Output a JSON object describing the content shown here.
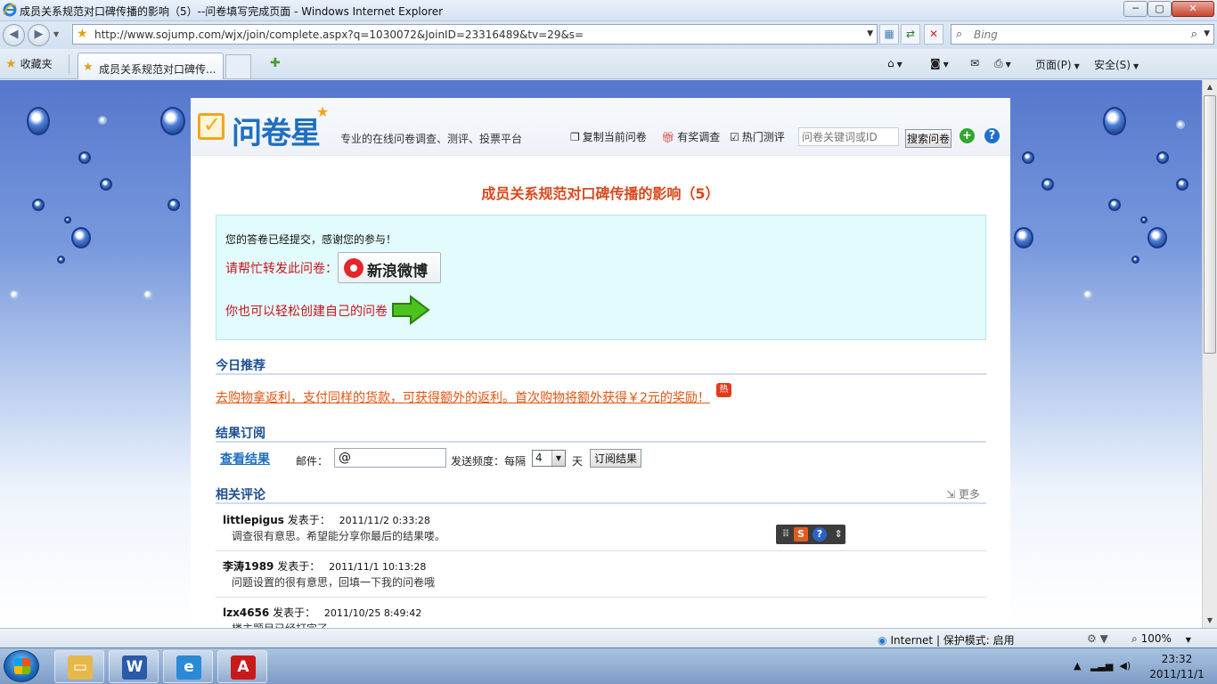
{
  "window": {
    "title": "成员关系规范对口碑传播的影响（5）--问卷填写完成页面 - Windows Internet Explorer",
    "min": "─",
    "max": "▢",
    "close": "✕"
  },
  "addressbar": {
    "url": "http://www.sojump.com/wjx/join/complete.aspx?q=1030072&JoinID=23316489&tv=29&s=",
    "search_placeholder": "Bing"
  },
  "favorites": {
    "label": "收藏夹",
    "tab_title": "成员关系规范对口碑传..."
  },
  "commandbar": {
    "page_menu": "页面(P)",
    "safety_menu": "安全(S)"
  },
  "site": {
    "logo_text": "问卷星",
    "slogan": "专业的在线问卷调查、测评、投票平台",
    "links": {
      "copy": "复制当前问卷",
      "reward": "有奖调查",
      "hot": "热门测评"
    },
    "search_placeholder": "问卷关键词或ID",
    "search_button": "搜索问卷"
  },
  "survey": {
    "title": "成员关系规范对口碑传播的影响（5）",
    "thanks": "您的答卷已经提交，感谢您的参与！",
    "share_label": "请帮忙转发此问卷：",
    "weibo_label": "新浪微博",
    "create_label": "你也可以轻松创建自己的问卷"
  },
  "recommend": {
    "title": "今日推荐",
    "promo": "去购物拿返利，支付同样的货款，可获得额外的返利。首次购物将额外获得￥2元的奖励！",
    "badge": "热"
  },
  "subscribe": {
    "title": "结果订阅",
    "view_result": "查看结果",
    "mail_label": "邮件：",
    "mail_value": "@",
    "freq_label": "发送频度：每隔",
    "freq_value": "4",
    "day_label": "天",
    "button": "订阅结果"
  },
  "comments": {
    "title": "相关评论",
    "more": "更多",
    "posted_label": "发表于：",
    "items": [
      {
        "user": "littlepigus",
        "time": "2011/11/2 0:33:28",
        "text": "调查很有意思。希望能分享你最后的结果喽。"
      },
      {
        "user": "李涛1989",
        "time": "2011/11/1 10:13:28",
        "text": "问题设置的很有意思，回填一下我的问卷哦"
      },
      {
        "user": "lzx4656",
        "time": "2011/10/25 8:49:42",
        "text": "楼主题目已经打完了"
      }
    ]
  },
  "statusbar": {
    "zone": "Internet | 保护模式: 启用",
    "zoom": "100%"
  },
  "taskbar": {
    "time": "23:32",
    "date": "2011/11/1"
  }
}
